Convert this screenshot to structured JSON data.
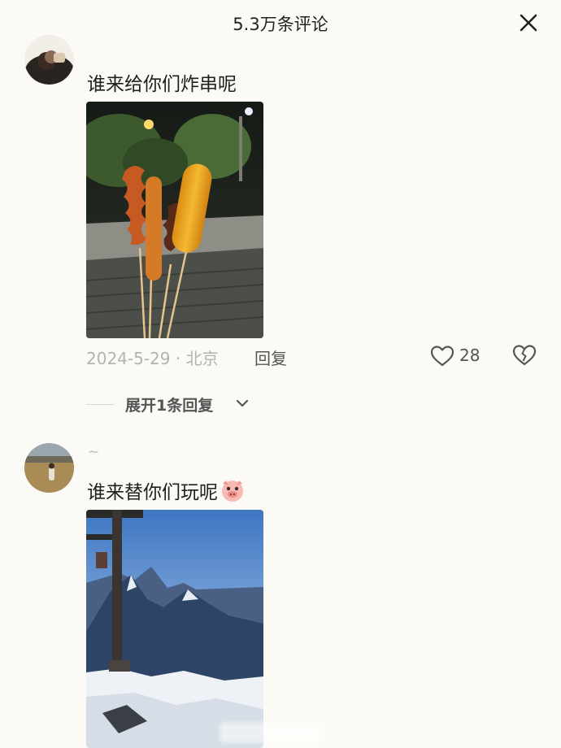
{
  "header": {
    "title": "5.3万条评论",
    "close_icon": "close-icon"
  },
  "comments": [
    {
      "username": "",
      "text": "谁来给你们炸串呢",
      "image": "fried skewers photo",
      "date_location": "2024-5-29 · 北京",
      "reply_label": "回复",
      "likes": "28",
      "expand_label": "展开1条回复"
    },
    {
      "username": "~",
      "text": "谁来替你们玩呢",
      "emoji": "pig-face-emoji",
      "image": "snowy mountain photo"
    }
  ],
  "colors": {
    "background": "#fbfaf5",
    "text_primary": "#1f1f1f",
    "text_secondary": "#b3b3b3",
    "icon_gray": "#555555"
  }
}
